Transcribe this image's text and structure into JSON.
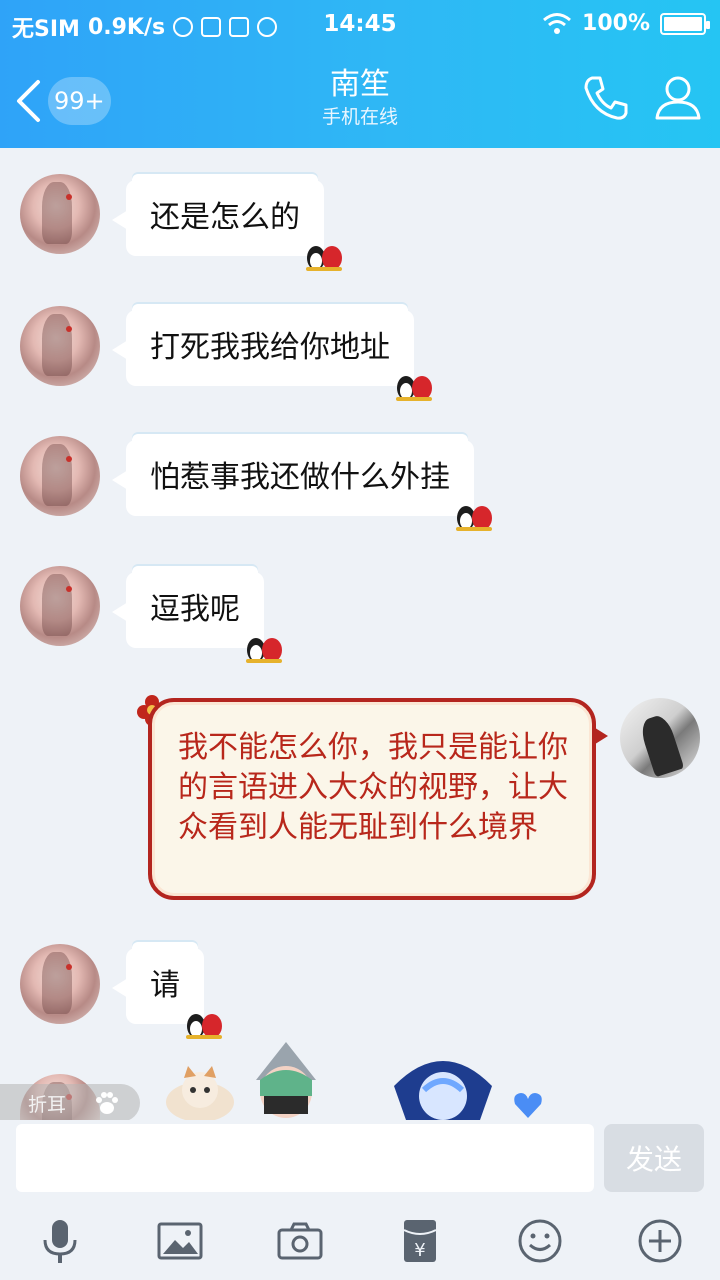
{
  "status": {
    "carrier": "无SIM",
    "speed": "0.9K/s",
    "time": "14:45",
    "battery": "100%",
    "battery_level": 1.0
  },
  "header": {
    "badge": "99+",
    "title": "南笙",
    "subtitle": "手机在线"
  },
  "messages": [
    {
      "text": "还是怎么的"
    },
    {
      "text": "打死我我给你地址"
    },
    {
      "text": "怕惹事我还做什么外挂"
    },
    {
      "text": "逗我呢"
    },
    {
      "text": "我不能怎么你，我只是能让你的言语进入大众的视野，让大众看到人能无耻到什么境界"
    },
    {
      "text": "请"
    }
  ],
  "collapse_tag": "折耳",
  "input": {
    "placeholder": "",
    "send_label": "发送"
  },
  "toolbar": [
    "mic-icon",
    "image-icon",
    "camera-icon",
    "red-packet-icon",
    "emoji-icon",
    "plus-icon"
  ],
  "colors": {
    "header_blue": "#2fa3f8",
    "self_bubble_border": "#b3251f",
    "self_bubble_text": "#b8271b",
    "icon_gray": "#5a6470"
  }
}
